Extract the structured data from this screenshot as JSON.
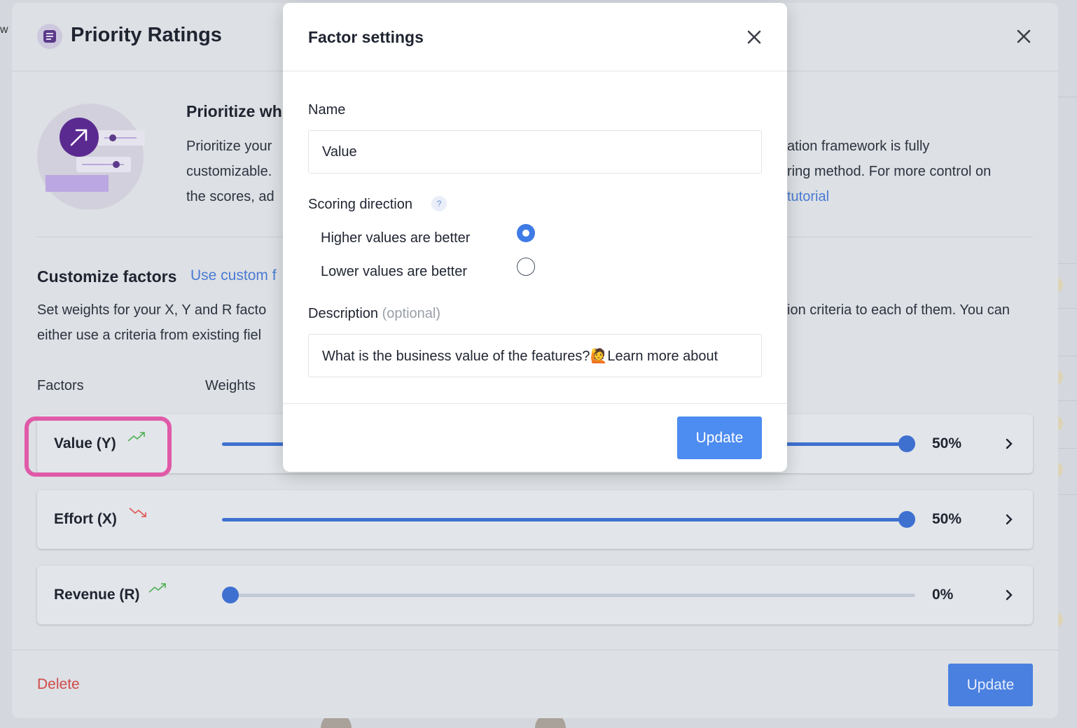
{
  "background": {
    "edge_letter": "w"
  },
  "main_modal": {
    "title": "Priority Ratings",
    "intro": {
      "title": "Prioritize wh",
      "lines_left": [
        "Prioritize your",
        "customizable.",
        "the scores, ad"
      ],
      "lines_right": [
        "ation framework is fully",
        "ring method. For more control on"
      ],
      "link_right": "tutorial"
    },
    "customize": {
      "title": "Customize factors",
      "link": "Use custom f",
      "line1_left": "Set weights for your X, Y and R facto",
      "line1_right": "ion criteria to each of them. You can",
      "line2_left": "either use a criteria from existing fiel"
    },
    "columns": {
      "factors": "Factors",
      "weights": "Weights"
    },
    "factors": [
      {
        "name": "Value (Y)",
        "trend": "trend-up-icon",
        "trend_color": "#4caf50",
        "weight": 50,
        "weight_label": "50%"
      },
      {
        "name": "Effort (X)",
        "trend": "trend-down-icon",
        "trend_color": "#e05252",
        "weight": 50,
        "weight_label": "50%"
      },
      {
        "name": "Revenue (R)",
        "trend": "trend-up-icon",
        "trend_color": "#4caf50",
        "weight": 0,
        "weight_label": "0%"
      }
    ],
    "delete_label": "Delete",
    "update_label": "Update"
  },
  "dialog": {
    "title": "Factor settings",
    "name_label": "Name",
    "name_value": "Value",
    "direction_label": "Scoring direction",
    "help": "?",
    "options": [
      {
        "label": "Higher values are better",
        "selected": true
      },
      {
        "label": "Lower values are better",
        "selected": false
      }
    ],
    "description_label": "Description",
    "description_optional": "(optional)",
    "description_value": "What is the business value of the features?🙋Learn more about",
    "update_label": "Update"
  },
  "colors": {
    "accent": "#4d8cf0",
    "highlight": "#e05aa8",
    "danger": "#d04a4a"
  }
}
